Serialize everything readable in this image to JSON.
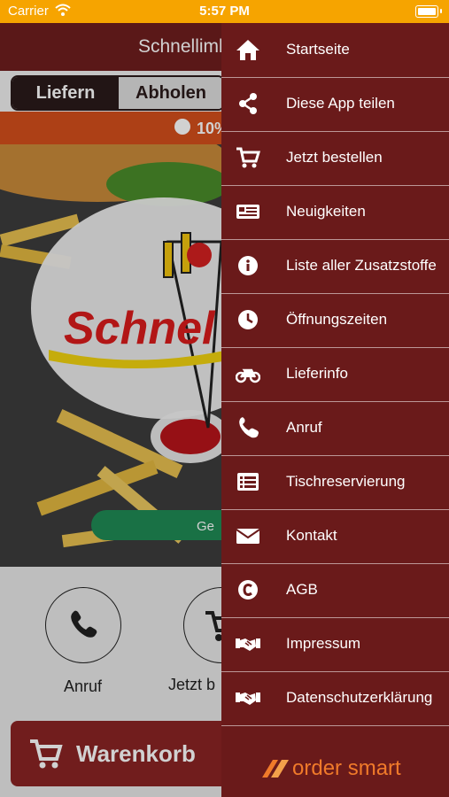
{
  "status_bar": {
    "carrier": "Carrier",
    "time": "5:57 PM"
  },
  "header": {
    "title": "Schnellimb"
  },
  "order_mode": {
    "delivery": "Liefern",
    "pickup": "Abholen"
  },
  "promo": {
    "text": "10%"
  },
  "hero": {
    "logo_text": "Schnel",
    "button_text": "Ge"
  },
  "quick_actions": {
    "call": "Anruf",
    "order": "Jetzt b"
  },
  "cart": {
    "label": "Warenkorb"
  },
  "drawer": {
    "items": [
      {
        "label": "Startseite",
        "icon": "home-icon"
      },
      {
        "label": "Diese App teilen",
        "icon": "share-icon"
      },
      {
        "label": "Jetzt bestellen",
        "icon": "cart-icon"
      },
      {
        "label": "Neuigkeiten",
        "icon": "news-icon"
      },
      {
        "label": "Liste aller Zusatzstoffe",
        "icon": "info-icon"
      },
      {
        "label": "Öffnungszeiten",
        "icon": "clock-icon"
      },
      {
        "label": "Lieferinfo",
        "icon": "motorcycle-icon"
      },
      {
        "label": "Anruf",
        "icon": "phone-icon"
      },
      {
        "label": "Tischreservierung",
        "icon": "list-icon"
      },
      {
        "label": "Kontakt",
        "icon": "envelope-icon"
      },
      {
        "label": "AGB",
        "icon": "copyright-icon"
      },
      {
        "label": "Impressum",
        "icon": "handshake-icon"
      },
      {
        "label": "Datenschutzerklärung",
        "icon": "handshake-icon"
      }
    ],
    "brand": "order smart"
  },
  "colors": {
    "status_bar": "#f6a400",
    "header": "#6e1e1e",
    "drawer": "#6a1a1a",
    "promo": "#d34f1c",
    "brand": "#f07a2a"
  }
}
